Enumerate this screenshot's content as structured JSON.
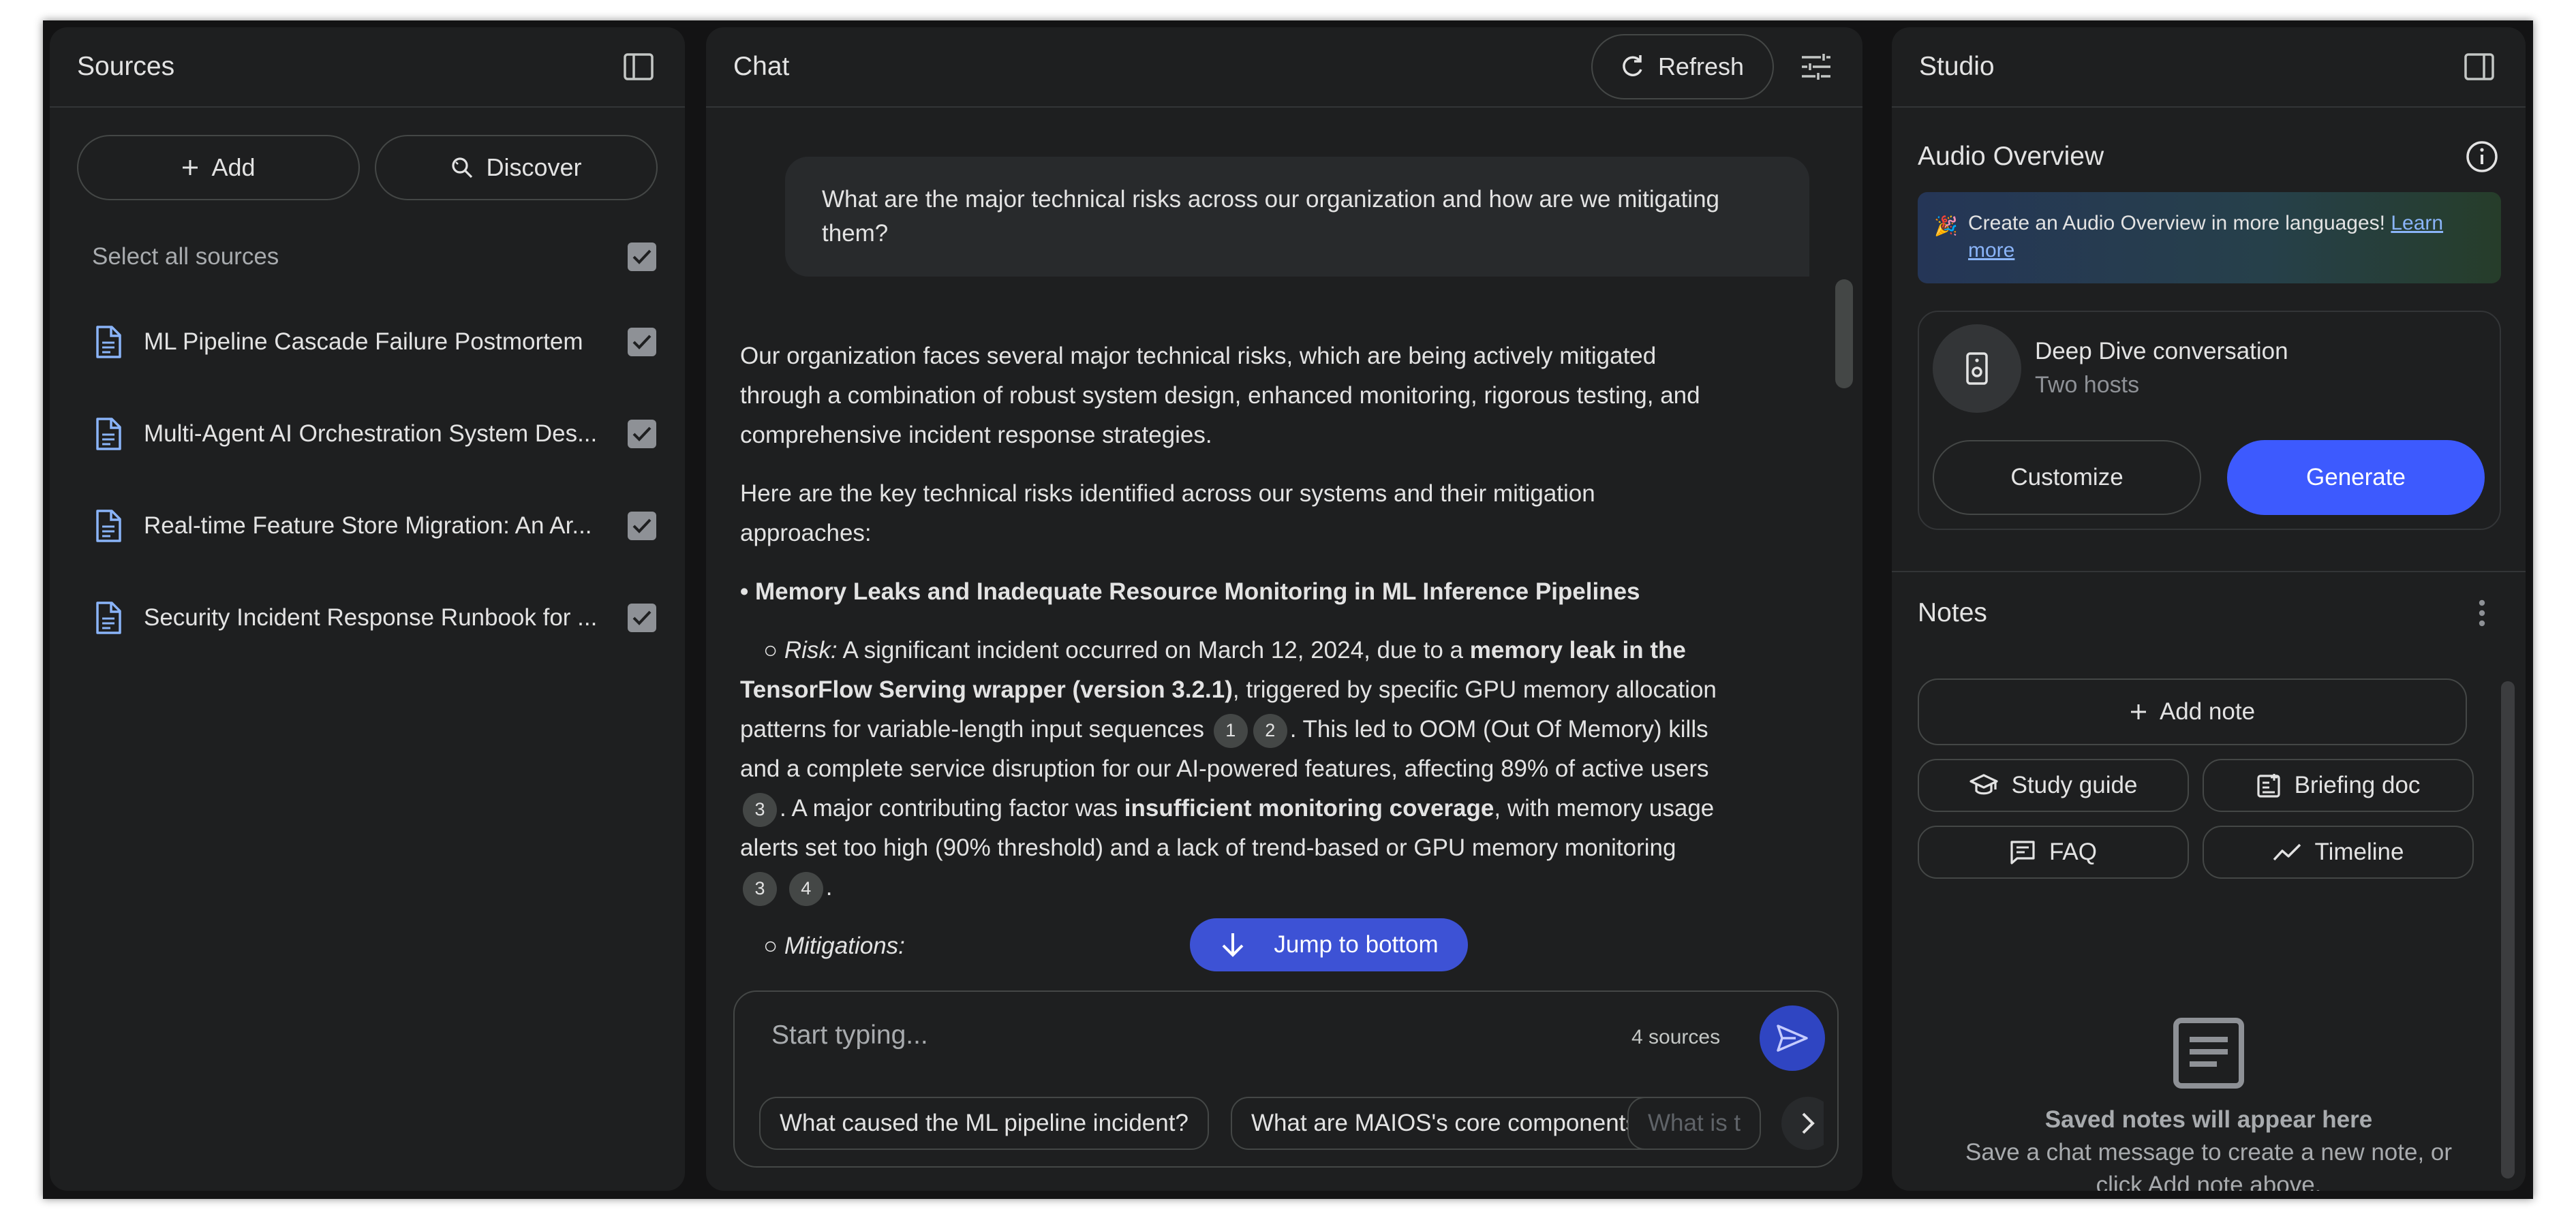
{
  "sources": {
    "title": "Sources",
    "add_label": "Add",
    "discover_label": "Discover",
    "select_all_label": "Select all sources",
    "items": [
      {
        "name": "ML Pipeline Cascade Failure Postmortem",
        "checked": true
      },
      {
        "name": "Multi-Agent AI Orchestration System Des...",
        "checked": true
      },
      {
        "name": "Real-time Feature Store Migration: An Ar...",
        "checked": true
      },
      {
        "name": "Security Incident Response Runbook for ...",
        "checked": true
      }
    ]
  },
  "chat": {
    "title": "Chat",
    "refresh_label": "Refresh",
    "user_message": "What are the major technical risks across our organization and how are we mitigating them?",
    "answer": {
      "intro": "Our organization faces several major technical risks, which are being actively mitigated through a combination of robust system design, enhanced monitoring, rigorous testing, and comprehensive incident response strategies.",
      "lead": "Here are the key technical risks identified across our systems and their mitigation approaches:",
      "bullet_title": "Memory Leaks and Inadequate Resource Monitoring in ML Inference Pipelines",
      "risk_label": "Risk:",
      "risk_t1": " A significant incident occurred on March 12, 2024, due to a ",
      "risk_b1": "memory leak in the TensorFlow Serving wrapper (version 3.2.1)",
      "risk_t2": ", triggered by specific GPU memory allocation patterns for variable-length input sequences ",
      "cite_1": "1",
      "cite_2": "2",
      "risk_t3": ". This led to OOM (Out Of Memory) kills and a complete service disruption for our AI-powered features, affecting 89% of active users ",
      "cite_3": "3",
      "risk_t4": ". A major contributing factor was ",
      "risk_b2": "insufficient monitoring coverage",
      "risk_t5": ", with memory usage alerts set too high (90% threshold) and a lack of trend-based or GPU memory monitoring ",
      "cite_4": "3",
      "cite_5": "4",
      "risk_t6": ".",
      "mitigations_label": "Mitigations:"
    },
    "jump_label": "Jump to bottom",
    "composer": {
      "placeholder": "Start typing...",
      "source_count": "4 sources"
    },
    "suggestions": [
      "What caused the ML pipeline incident?",
      "What are MAIOS's core components?",
      "What is t"
    ]
  },
  "studio": {
    "title": "Studio",
    "audio_overview_title": "Audio Overview",
    "banner_text": "Create an Audio Overview in more languages! ",
    "banner_link": "Learn more",
    "deep_dive_title": "Deep Dive conversation",
    "deep_dive_sub": "Two hosts",
    "customize_label": "Customize",
    "generate_label": "Generate",
    "notes_title": "Notes",
    "add_note_label": "Add note",
    "note_buttons": [
      "Study guide",
      "Briefing doc",
      "FAQ",
      "Timeline"
    ],
    "empty_title": "Saved notes will appear here",
    "empty_desc": "Save a chat message to create a new note, or click Add note above."
  },
  "colors": {
    "accent": "#3d5afe",
    "panel_bg": "#1e1f20",
    "app_bg": "#131314",
    "jump_bg": "#3d52d5"
  }
}
